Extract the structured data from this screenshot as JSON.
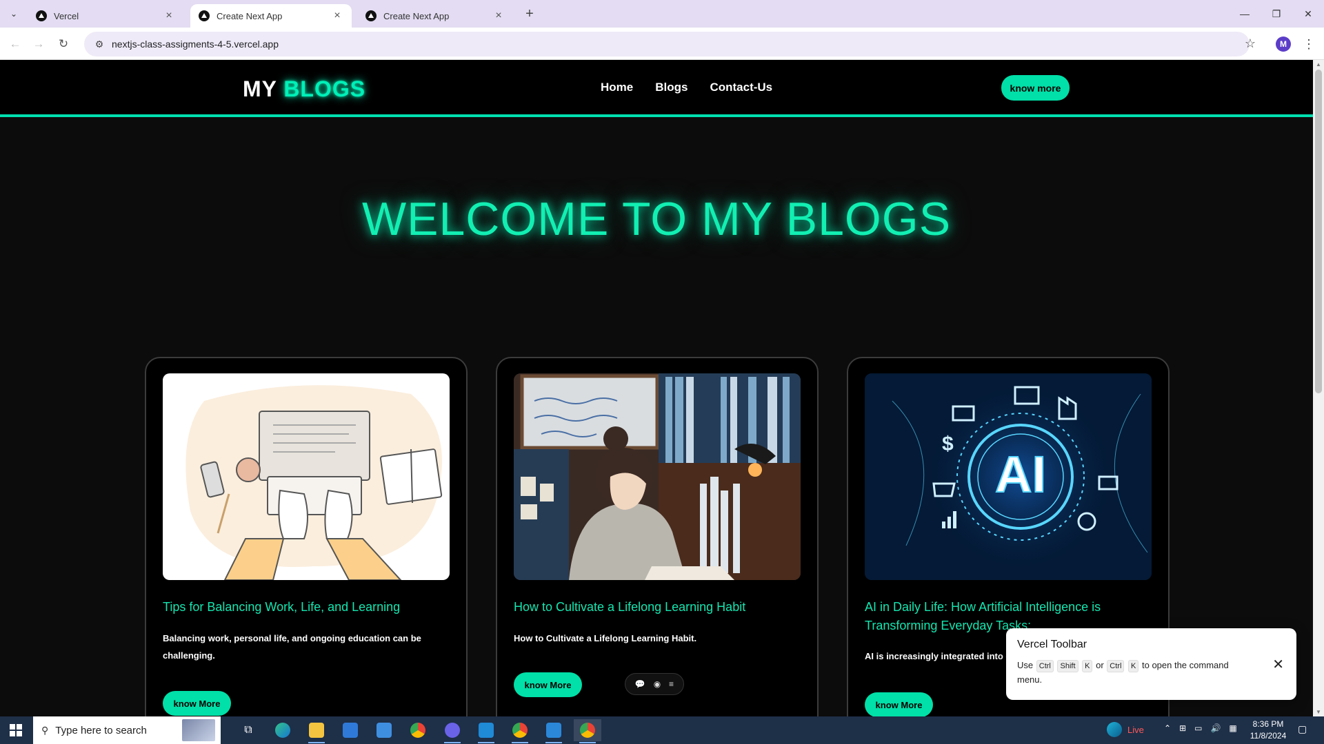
{
  "browser": {
    "tabs": [
      {
        "title": "Vercel"
      },
      {
        "title": "Create Next App"
      },
      {
        "title": "Create Next App"
      }
    ],
    "active_tab": 1,
    "url": "nextjs-class-assigments-4-5.vercel.app",
    "profile_initial": "M"
  },
  "site": {
    "logo_prefix": "MY",
    "logo_accent": "BLOGS",
    "nav": [
      "Home",
      "Blogs",
      "Contact-Us"
    ],
    "header_cta": "know more",
    "hero_title": "WELCOME TO MY BLOGS",
    "accent_color": "#00e0a8"
  },
  "cards": [
    {
      "image": "laptop-typing-illustration",
      "title": "Tips for Balancing Work, Life, and Learning",
      "desc": "Balancing work, personal life, and ongoing education can be challenging.",
      "button": "know More"
    },
    {
      "image": "girl-studying-illustration",
      "title": "How to Cultivate a Lifelong Learning Habit",
      "desc": "How to Cultivate a Lifelong Learning Habit.",
      "button": "know More"
    },
    {
      "image": "ai-circuit-illustration",
      "image_text": "AI",
      "title": "AI in Daily Life: How Artificial Intelligence is Transforming Everyday Tasks:",
      "desc": "AI is increasingly integrated into eve",
      "button": "know More"
    }
  ],
  "vercel_toolbar": {
    "title": "Vercel Toolbar",
    "use": "Use",
    "keys1": [
      "Ctrl",
      "Shift",
      "K"
    ],
    "or": "or",
    "keys2": [
      "Ctrl",
      "K"
    ],
    "suffix": "to open the command menu."
  },
  "taskbar": {
    "search_placeholder": "Type here to search",
    "weather_text": "Live",
    "time": "8:36 PM",
    "date": "11/8/2024"
  }
}
